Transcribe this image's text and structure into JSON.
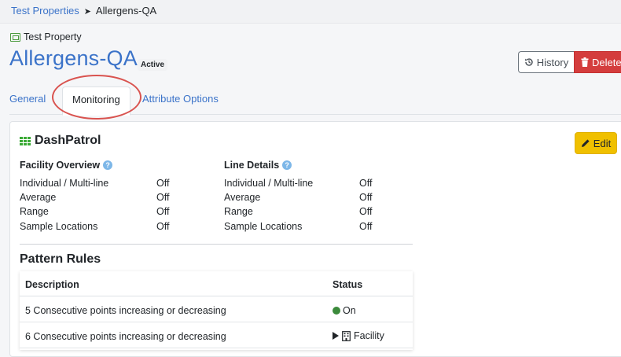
{
  "breadcrumb": {
    "parent": "Test Properties",
    "separator": "➤",
    "current": "Allergens-QA"
  },
  "header": {
    "type_label": "Test Property",
    "title": "Allergens-QA",
    "status_badge": "Active",
    "history_label": "History",
    "delete_label": "Delete"
  },
  "tabs": [
    {
      "label": "General"
    },
    {
      "label": "Monitoring"
    },
    {
      "label": "Attribute Options"
    }
  ],
  "dashpatrol": {
    "title": "DashPatrol",
    "edit_label": "Edit",
    "facility_overview": {
      "heading": "Facility Overview",
      "rows": [
        {
          "label": "Individual / Multi-line",
          "value": "Off"
        },
        {
          "label": "Average",
          "value": "Off"
        },
        {
          "label": "Range",
          "value": "Off"
        },
        {
          "label": "Sample Locations",
          "value": "Off"
        }
      ]
    },
    "line_details": {
      "heading": "Line Details",
      "rows": [
        {
          "label": "Individual / Multi-line",
          "value": "Off"
        },
        {
          "label": "Average",
          "value": "Off"
        },
        {
          "label": "Range",
          "value": "Off"
        },
        {
          "label": "Sample Locations",
          "value": "Off"
        }
      ]
    }
  },
  "pattern_rules": {
    "title": "Pattern Rules",
    "columns": {
      "description": "Description",
      "status": "Status"
    },
    "rows": [
      {
        "description": "5 Consecutive points increasing or decreasing",
        "status": "On"
      },
      {
        "description": "6 Consecutive points increasing or decreasing",
        "status": "Facility"
      }
    ]
  },
  "colors": {
    "link": "#3b73c9",
    "danger": "#d43d3d",
    "warning": "#f0c000",
    "on_green": "#3b8a3b",
    "annotation_red": "#d9534f"
  }
}
